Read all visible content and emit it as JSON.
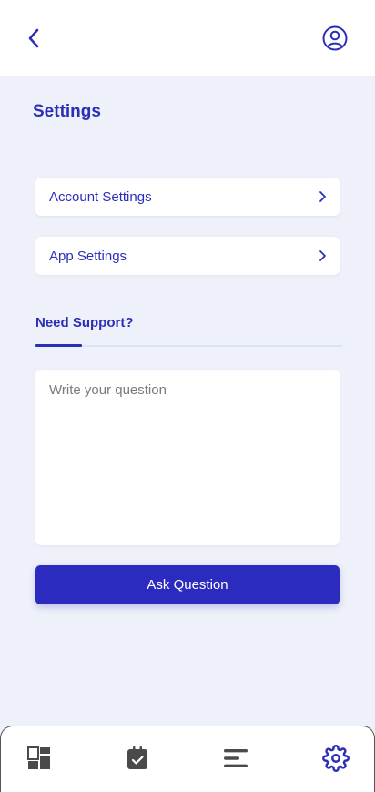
{
  "header": {
    "back_icon": "chevron-left-icon",
    "profile_icon": "user-circle-icon"
  },
  "page": {
    "title": "Settings"
  },
  "menu": [
    {
      "label": "Account Settings",
      "icon": "chevron-right-icon"
    },
    {
      "label": "App Settings",
      "icon": "chevron-right-icon"
    }
  ],
  "support": {
    "tab_label": "Need Support?",
    "placeholder": "Write your question",
    "value": "",
    "button_label": "Ask Question"
  },
  "bottom_nav": [
    {
      "id": "dashboard",
      "icon": "dashboard-icon",
      "active": false
    },
    {
      "id": "calendar",
      "icon": "calendar-check-icon",
      "active": false
    },
    {
      "id": "list",
      "icon": "menu-lines-icon",
      "active": false
    },
    {
      "id": "settings",
      "icon": "gear-icon",
      "active": true
    }
  ],
  "colors": {
    "accent": "#2b2fb8",
    "button": "#2b2bc0",
    "background": "#eef1f9",
    "card": "#ffffff",
    "inactive_icon": "#4a4a4a"
  }
}
